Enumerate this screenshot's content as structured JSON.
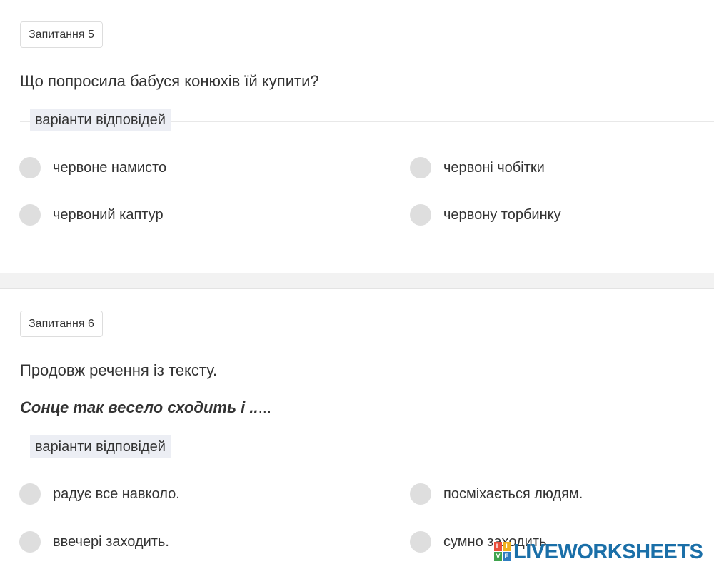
{
  "questions": [
    {
      "badge": "Запитання 5",
      "text": "Що попросила бабуся конюхів їй купити?",
      "variants_label": "варіанти відповідей",
      "options": [
        "червоне намисто",
        "червоні чобітки",
        "червоний каптур",
        "червону торбинку"
      ]
    },
    {
      "badge": "Запитання 6",
      "text": "Продовж речення із тексту.",
      "sentence_bold": "Сонце так весело сходить і ..",
      "sentence_tail": "...",
      "variants_label": "варіанти відповідей",
      "options": [
        "радує все навколо.",
        "посміхається людям.",
        "ввечері заходить.",
        "сумно заходить."
      ]
    }
  ],
  "watermark": {
    "logo_letters": [
      "L",
      "I",
      "V",
      "E"
    ],
    "text": "LIVEWORKSHEETS"
  },
  "colors": {
    "radio": "#dedede",
    "legend_bg": "#eceef4",
    "separator": "#f2f2f2",
    "watermark": "#1a6fa8"
  }
}
